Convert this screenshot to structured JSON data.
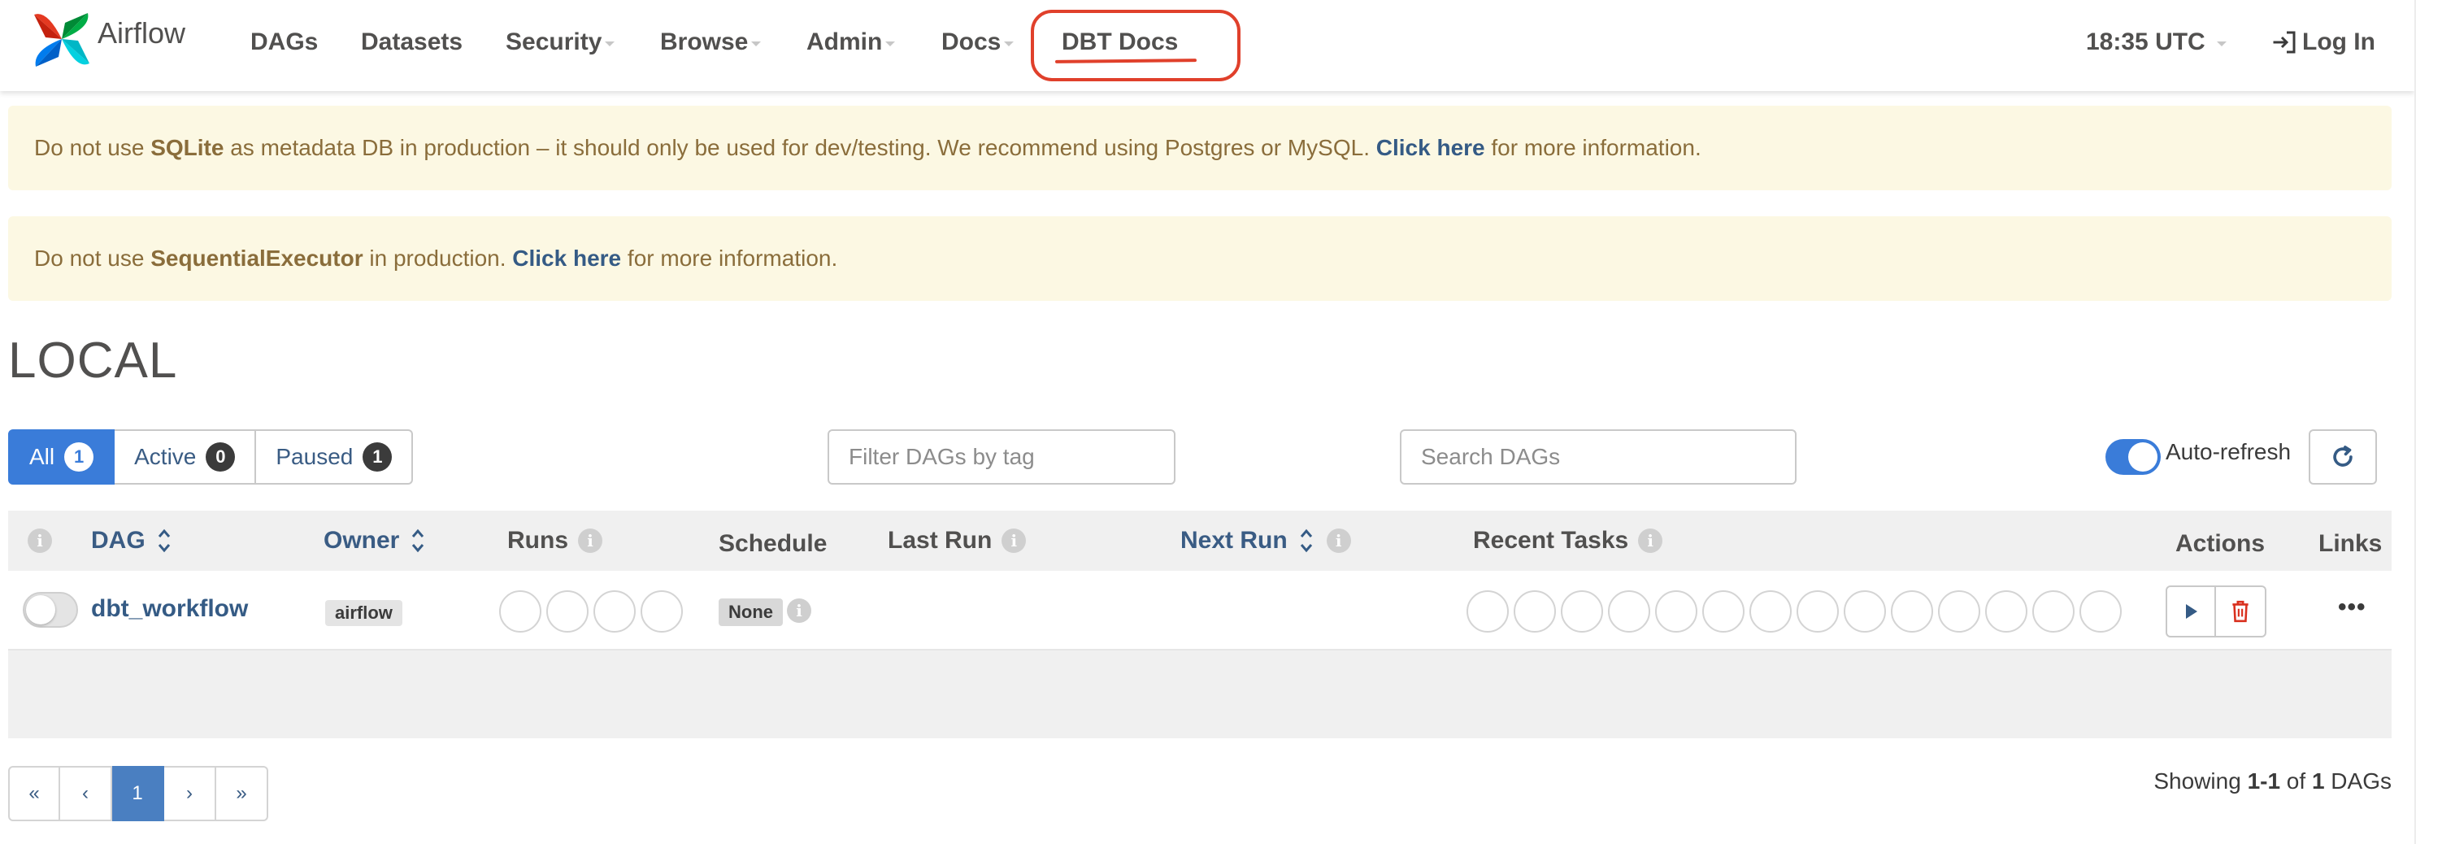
{
  "navbar": {
    "brand": "Airflow",
    "items": [
      {
        "label": "DAGs",
        "dropdown": false
      },
      {
        "label": "Datasets",
        "dropdown": false
      },
      {
        "label": "Security",
        "dropdown": true
      },
      {
        "label": "Browse",
        "dropdown": true
      },
      {
        "label": "Admin",
        "dropdown": true
      },
      {
        "label": "Docs",
        "dropdown": true
      },
      {
        "label": "DBT Docs",
        "dropdown": false
      }
    ],
    "time": "18:35 UTC",
    "login": "Log In"
  },
  "alerts": [
    {
      "p1": "Do not use ",
      "b1": "SQLite",
      "p2": " as metadata DB in production – it should only be used for dev/testing. We recommend using Postgres or MySQL. ",
      "link": "Click here",
      "p3": " for more information."
    },
    {
      "p1": "Do not use ",
      "b1": "SequentialExecutor",
      "p2": " in production. ",
      "link": "Click here",
      "p3": " for more information."
    }
  ],
  "page_title": "LOCAL",
  "filters": {
    "all": {
      "label": "All",
      "count": "1"
    },
    "active": {
      "label": "Active",
      "count": "0"
    },
    "paused": {
      "label": "Paused",
      "count": "1"
    },
    "tag_placeholder": "Filter DAGs by tag",
    "search_placeholder": "Search DAGs",
    "auto_refresh": "Auto-refresh",
    "auto_refresh_on": true
  },
  "table": {
    "headers": {
      "dag": "DAG",
      "owner": "Owner",
      "runs": "Runs",
      "schedule": "Schedule",
      "last_run": "Last Run",
      "next_run": "Next Run",
      "recent_tasks": "Recent Tasks",
      "actions": "Actions",
      "links": "Links"
    },
    "rows": [
      {
        "dag_id": "dbt_workflow",
        "owner": "airflow",
        "schedule": "None",
        "paused": true,
        "links": "•••"
      }
    ]
  },
  "pagination": {
    "first": "«",
    "prev": "‹",
    "current": "1",
    "next": "›",
    "last": "»"
  },
  "showing": {
    "prefix": "Showing ",
    "range": "1-1",
    "of": " of ",
    "total": "1",
    "suffix": " DAGs"
  },
  "colors": {
    "accent": "#3a7cd9",
    "highlight": "#e0402b",
    "alert_bg": "#fcf8e3",
    "link": "#355b85"
  }
}
